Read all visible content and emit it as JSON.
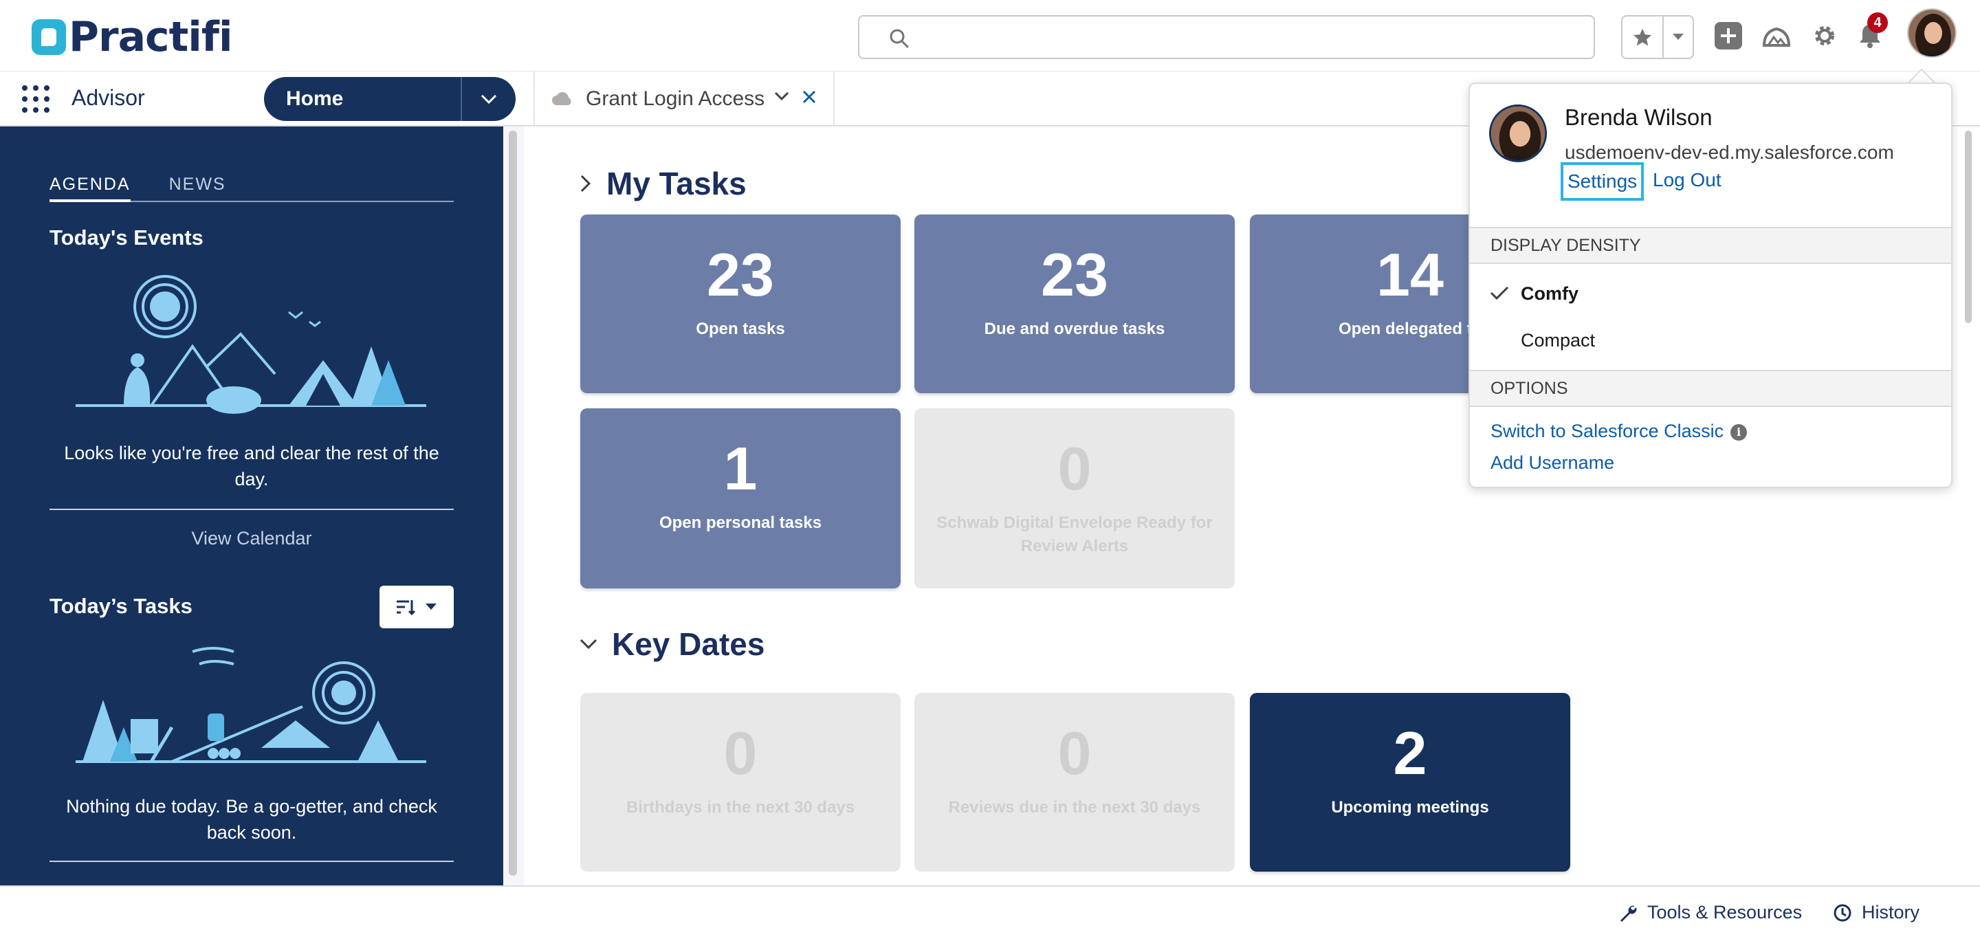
{
  "brand": {
    "name": "Practifi",
    "color": "#16325c",
    "accent": "#2bb3d6"
  },
  "header": {
    "search_placeholder": "",
    "notification_count": "4",
    "icons": [
      "search-icon",
      "star-icon",
      "chevron-down-icon",
      "add-icon",
      "trailhead-icon",
      "gear-icon",
      "bell-icon"
    ]
  },
  "nav": {
    "app_name": "Advisor",
    "home_tab": "Home",
    "workspace_tab": "Grant Login Access"
  },
  "sidebar": {
    "tabs": [
      "AGENDA",
      "NEWS"
    ],
    "events_title": "Today's Events",
    "events_empty": "Looks like you're free and clear the rest of the day.",
    "view_calendar": "View Calendar",
    "tasks_title": "Today’s Tasks",
    "tasks_empty": "Nothing due today. Be a go-getter, and check back soon."
  },
  "my_tasks": {
    "title": "My Tasks",
    "tiles": [
      {
        "value": "23",
        "label": "Open tasks",
        "state": "active"
      },
      {
        "value": "23",
        "label": "Due and overdue tasks",
        "state": "active"
      },
      {
        "value": "14",
        "label": "Open delegated ta",
        "state": "active"
      },
      {
        "value": "1",
        "label": "Open personal tasks",
        "state": "active"
      },
      {
        "value": "0",
        "label": "Schwab Digital Envelope Ready for Review Alerts",
        "state": "empty"
      }
    ]
  },
  "key_dates": {
    "title": "Key Dates",
    "tiles": [
      {
        "value": "0",
        "label": "Birthdays in the next 30 days",
        "state": "empty"
      },
      {
        "value": "0",
        "label": "Reviews due in the next 30 days",
        "state": "empty"
      },
      {
        "value": "2",
        "label": "Upcoming meetings",
        "state": "highlight"
      }
    ]
  },
  "user_menu": {
    "name": "Brenda Wilson",
    "domain": "usdemoenv-dev-ed.my.salesforce.com",
    "settings": "Settings",
    "logout": "Log Out",
    "density_header": "DISPLAY DENSITY",
    "density_options": [
      "Comfy",
      "Compact"
    ],
    "density_selected": "Comfy",
    "options_header": "OPTIONS",
    "switch_classic": "Switch to Salesforce Classic",
    "add_username": "Add Username"
  },
  "utility_bar": {
    "tools": "Tools & Resources",
    "history": "History"
  }
}
